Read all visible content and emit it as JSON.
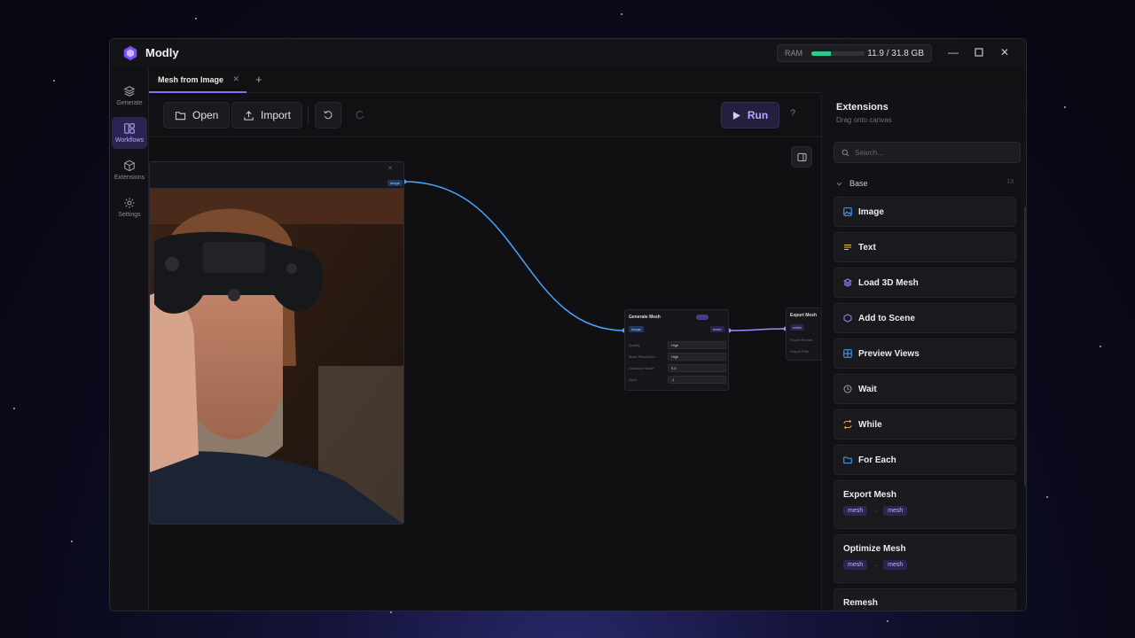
{
  "app": {
    "title": "Modly"
  },
  "ram": {
    "label": "RAM",
    "value": "11.9 / 31.8 GB",
    "usage_fraction": 0.374
  },
  "sidebar": {
    "items": [
      {
        "label": "Generate",
        "icon": "layers-icon",
        "active": false
      },
      {
        "label": "Workflows",
        "icon": "workflow-icon",
        "active": true
      },
      {
        "label": "Extensions",
        "icon": "cube-icon",
        "active": false
      },
      {
        "label": "Settings",
        "icon": "gear-icon",
        "active": false
      }
    ]
  },
  "tabs": [
    {
      "label": "Mesh from Image",
      "active": true
    }
  ],
  "toolbar": {
    "open_label": "Open",
    "import_label": "Import",
    "run_label": "Run",
    "help_label": "?"
  },
  "canvas": {
    "image_node": {
      "output_port": "image"
    },
    "generate_node": {
      "title": "Generate Mesh",
      "input_port": "image",
      "output_port": "mesh",
      "fields": [
        {
          "label": "Quality",
          "value": "High"
        },
        {
          "label": "Mesh Resolution",
          "value": "High"
        },
        {
          "label": "Guidance Scale",
          "value": "5.5"
        },
        {
          "label": "Seed",
          "value": "-1"
        }
      ]
    },
    "export_node": {
      "title": "Export Mesh",
      "input_port": "mesh",
      "fields": [
        "Export Format",
        "Output Path"
      ]
    }
  },
  "extensions_panel": {
    "title": "Extensions",
    "subtitle": "Drag onto canvas",
    "search_placeholder": "Search...",
    "section": {
      "label": "Base",
      "count": "13"
    },
    "items": [
      {
        "label": "Image",
        "icon": "image-icon",
        "color": "#4aa3ff"
      },
      {
        "label": "Text",
        "icon": "text-icon",
        "color": "#f5c542"
      },
      {
        "label": "Load 3D Mesh",
        "icon": "stack-icon",
        "color": "#9c8cff"
      },
      {
        "label": "Add to Scene",
        "icon": "hexagon-icon",
        "color": "#9c8cff"
      },
      {
        "label": "Preview Views",
        "icon": "grid-icon",
        "color": "#4aa3ff"
      },
      {
        "label": "Wait",
        "icon": "clock-icon",
        "color": "#a0a0aa"
      },
      {
        "label": "While",
        "icon": "loop-icon",
        "color": "#f59a3c"
      },
      {
        "label": "For Each",
        "icon": "folder-icon",
        "color": "#4aa3ff"
      }
    ],
    "tall_items": [
      {
        "label": "Export Mesh",
        "in": "mesh",
        "out": "mesh"
      },
      {
        "label": "Optimize Mesh",
        "in": "mesh",
        "out": "mesh"
      },
      {
        "label": "Remesh"
      }
    ]
  }
}
